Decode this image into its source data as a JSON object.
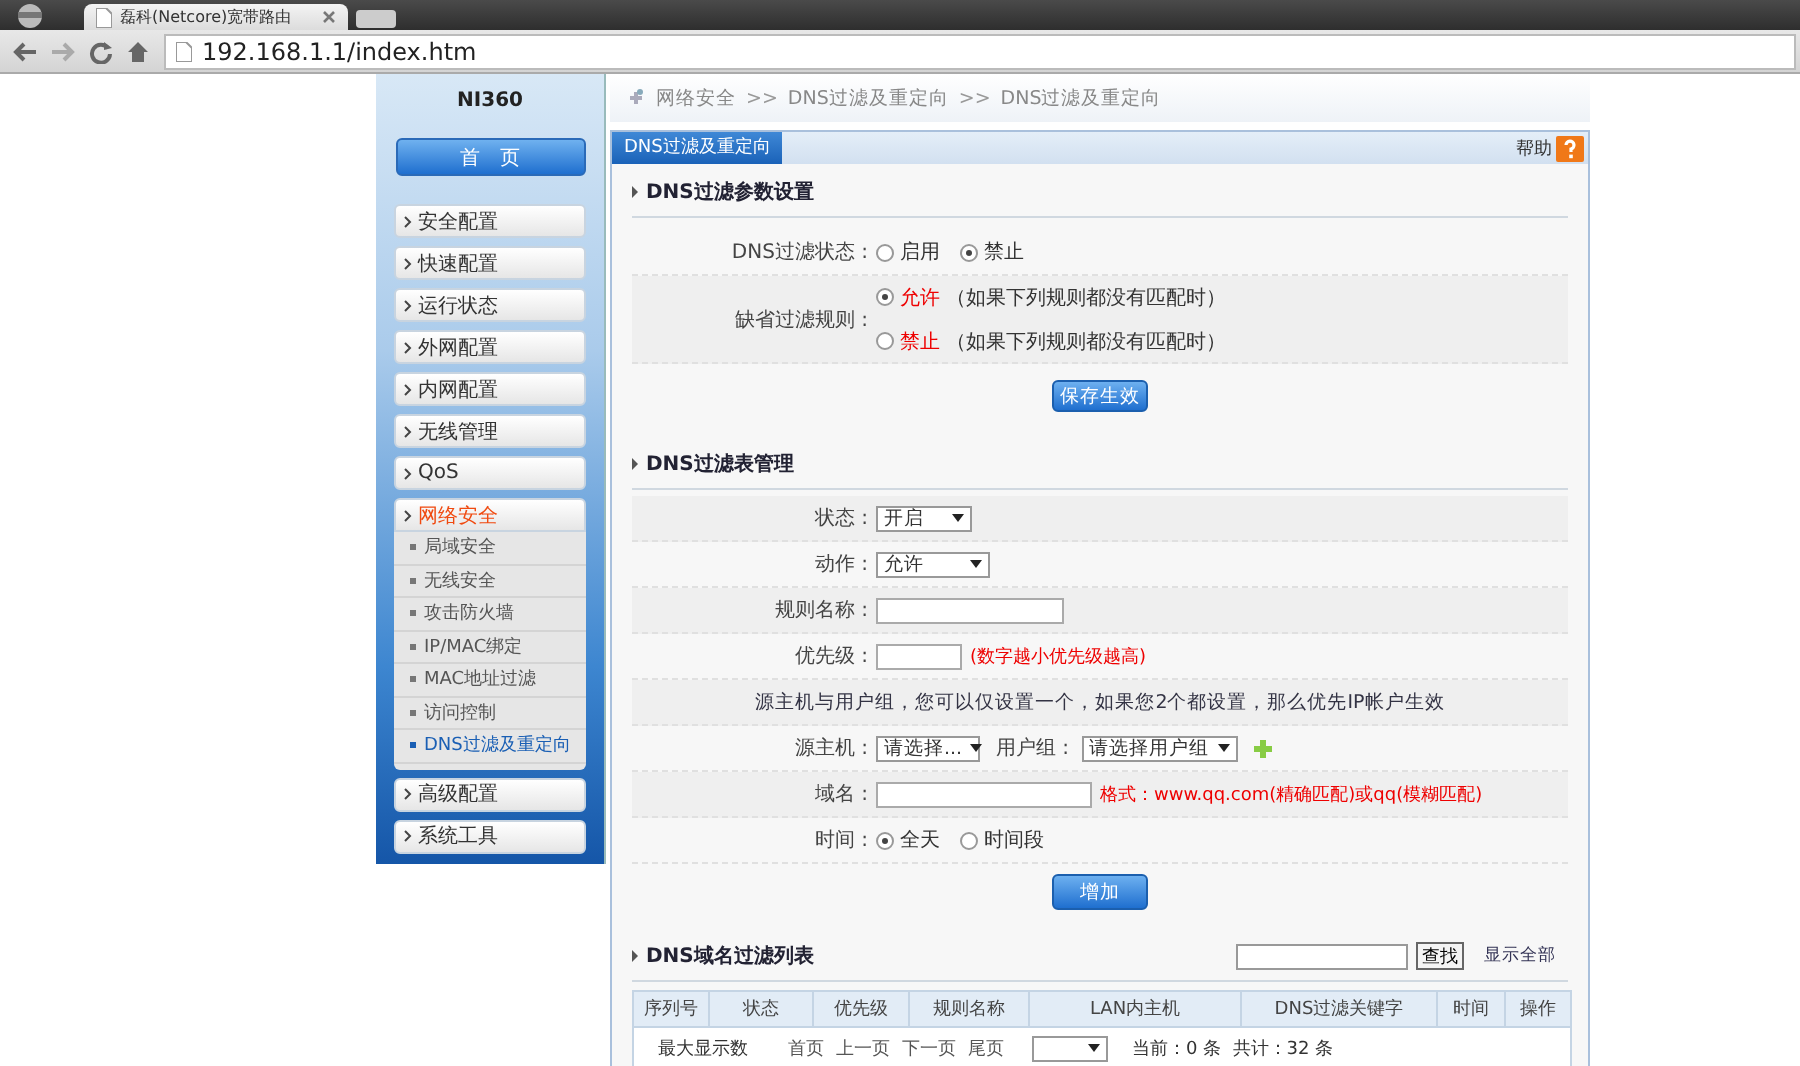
{
  "browser": {
    "tab_title": "磊科(Netcore)宽带路由",
    "address": "192.168.1.1/index.htm"
  },
  "sidebar": {
    "title": "NI360",
    "home": "首　页",
    "items": [
      {
        "label": "安全配置",
        "selected": false,
        "expanded": false
      },
      {
        "label": "快速配置",
        "selected": false,
        "expanded": false
      },
      {
        "label": "运行状态",
        "selected": false,
        "expanded": false
      },
      {
        "label": "外网配置",
        "selected": false,
        "expanded": false
      },
      {
        "label": "内网配置",
        "selected": false,
        "expanded": false
      },
      {
        "label": "无线管理",
        "selected": false,
        "expanded": false
      },
      {
        "label": "QoS",
        "selected": false,
        "expanded": false
      },
      {
        "label": "网络安全",
        "selected": true,
        "expanded": true,
        "children": [
          {
            "label": "局域安全",
            "selected": false
          },
          {
            "label": "无线安全",
            "selected": false
          },
          {
            "label": "攻击防火墙",
            "selected": false
          },
          {
            "label": "IP/MAC绑定",
            "selected": false
          },
          {
            "label": "MAC地址过滤",
            "selected": false
          },
          {
            "label": "访问控制",
            "selected": false
          },
          {
            "label": "DNS过滤及重定向",
            "selected": true
          }
        ]
      },
      {
        "label": "高级配置",
        "selected": false,
        "expanded": false
      },
      {
        "label": "系统工具",
        "selected": false,
        "expanded": false
      }
    ]
  },
  "breadcrumb": [
    "网络安全",
    ">>",
    "DNS过滤及重定向",
    ">>",
    "DNS过滤及重定向"
  ],
  "tabs": [
    {
      "label": "DNS过滤及重定向",
      "selected": true
    }
  ],
  "help": "帮助",
  "sections": [
    {
      "title": "DNS过滤参数设置",
      "rows": [
        {
          "kind": "radios",
          "label": "DNS过滤状态 :",
          "options": [
            {
              "text": "启用",
              "selected": false
            },
            {
              "text": "禁止",
              "selected": true
            }
          ]
        },
        {
          "kind": "radio_lines",
          "label": "缺省过滤规则 :",
          "options": [
            {
              "text": "允许",
              "note": "（如果下列规则都没有匹配时）",
              "selected": true
            },
            {
              "text": "禁止",
              "note": "（如果下列规则都没有匹配时）",
              "selected": false
            }
          ]
        }
      ],
      "button": "保存生效"
    },
    {
      "title": "DNS过滤表管理",
      "rows": [
        {
          "kind": "select",
          "label": "状态 :",
          "value": "开启"
        },
        {
          "kind": "select",
          "label": "动作 :",
          "value": "允许"
        },
        {
          "kind": "input",
          "label": "规则名称 :"
        },
        {
          "kind": "input",
          "label": "优先级 :",
          "hint": "(数字越小优先级越高)"
        },
        {
          "kind": "note",
          "text": "源主机与用户组，您可以仅设置一个，如果您2个都设置，那么优先IP帐户生效"
        },
        {
          "kind": "selects",
          "label": "源主机 :",
          "value": "请选择...",
          "label2": "用户组 :",
          "value2": "请选择用户组"
        },
        {
          "kind": "input",
          "label": "域名 :",
          "hint": "格式：www.qq.com(精确匹配)或qq(模糊匹配)"
        },
        {
          "kind": "radios",
          "label": "时间 :",
          "options": [
            {
              "text": "全天",
              "selected": true
            },
            {
              "text": "时间段",
              "selected": false
            }
          ]
        }
      ],
      "button": "增加"
    }
  ],
  "list": {
    "title": "DNS域名过滤列表",
    "search_button": "查找",
    "show_all": "显示全部",
    "columns": [
      "序列号",
      "状态",
      "优先级",
      "规则名称",
      "LAN内主机",
      "DNS过滤关键字",
      "时间",
      "操作"
    ],
    "footer": {
      "label": "最大显示数",
      "pages": [
        "首页",
        "上一页",
        "下一页",
        "尾页"
      ],
      "summary": "当前：0 条  共计：32 条"
    }
  }
}
